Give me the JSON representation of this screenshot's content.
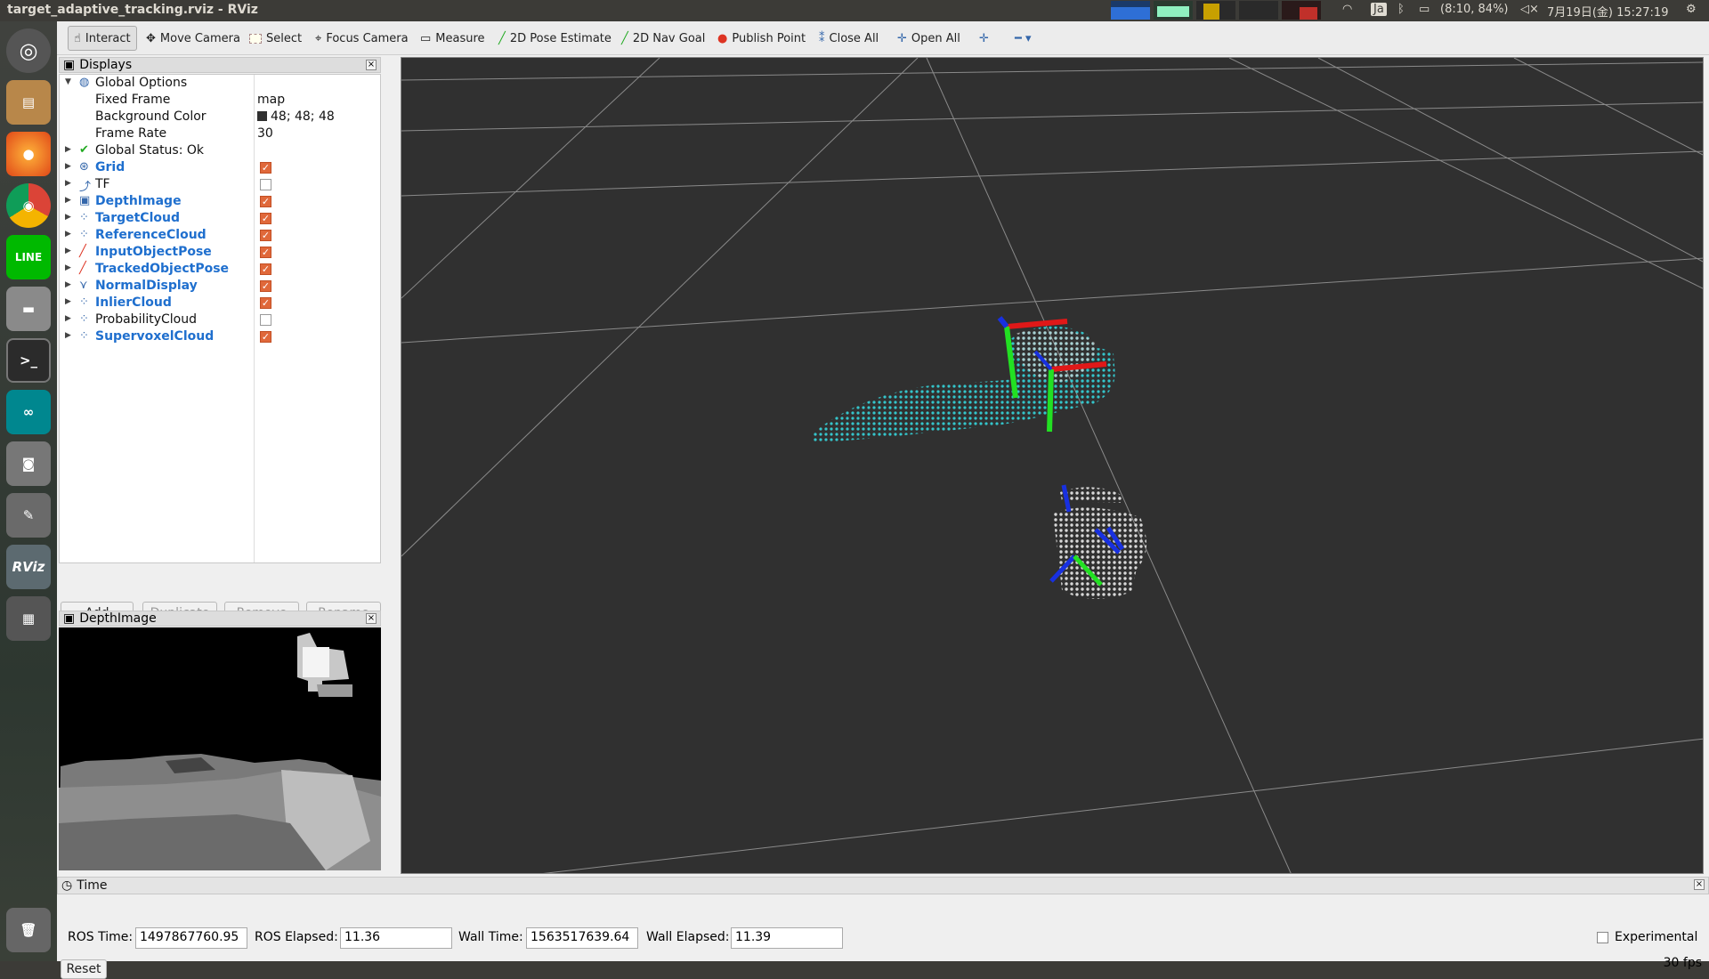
{
  "window_title": "target_adaptive_tracking.rviz - RViz",
  "indicators": {
    "lang": "Ja",
    "battery": "(8:10, 84%)",
    "clock": "7月19日(金) 15:27:19"
  },
  "toolbar": [
    "Interact",
    "Move Camera",
    "Select",
    "Focus Camera",
    "Measure",
    "2D Pose Estimate",
    "2D Nav Goal",
    "Publish Point",
    "Close All",
    "Open All"
  ],
  "toolbar_icons": [
    "hand-icon",
    "move-camera-icon",
    "select-icon",
    "focus-camera-icon",
    "measure-icon",
    "pose-estimate-icon",
    "nav-goal-icon",
    "publish-point-icon",
    "close-all-icon",
    "open-all-icon"
  ],
  "displays": {
    "title": "Displays",
    "global_options": "Global Options",
    "fixed_frame": {
      "label": "Fixed Frame",
      "value": "map"
    },
    "background_color": {
      "label": "Background Color",
      "value": "48; 48; 48",
      "swatch": "#303030"
    },
    "frame_rate": {
      "label": "Frame Rate",
      "value": "30"
    },
    "global_status": "Global Status: Ok",
    "items": [
      {
        "name": "Grid",
        "checked": true,
        "blue": true
      },
      {
        "name": "TF",
        "checked": false,
        "blue": false
      },
      {
        "name": "DepthImage",
        "checked": true,
        "blue": true
      },
      {
        "name": "TargetCloud",
        "checked": true,
        "blue": true
      },
      {
        "name": "ReferenceCloud",
        "checked": true,
        "blue": true
      },
      {
        "name": "InputObjectPose",
        "checked": true,
        "blue": true
      },
      {
        "name": "TrackedObjectPose",
        "checked": true,
        "blue": true
      },
      {
        "name": "NormalDisplay",
        "checked": true,
        "blue": true
      },
      {
        "name": "InlierCloud",
        "checked": true,
        "blue": true
      },
      {
        "name": "ProbabilityCloud",
        "checked": false,
        "blue": false
      },
      {
        "name": "SupervoxelCloud",
        "checked": true,
        "blue": true
      }
    ],
    "buttons": {
      "add": "Add",
      "duplicate": "Duplicate",
      "remove": "Remove",
      "rename": "Rename"
    }
  },
  "depth_panel": {
    "title": "DepthImage"
  },
  "time_panel": {
    "title": "Time",
    "ros_time_label": "ROS Time:",
    "ros_time": "1497867760.95",
    "ros_elapsed_label": "ROS Elapsed:",
    "ros_elapsed": "11.36",
    "wall_time_label": "Wall Time:",
    "wall_time": "1563517639.64",
    "wall_elapsed_label": "Wall Elapsed:",
    "wall_elapsed": "11.39",
    "experimental": "Experimental",
    "reset": "Reset",
    "fps": "30 fps"
  },
  "colors": {
    "accent": "#e0683a",
    "cloud": "#22d3d8",
    "link": "#1f6fce"
  }
}
